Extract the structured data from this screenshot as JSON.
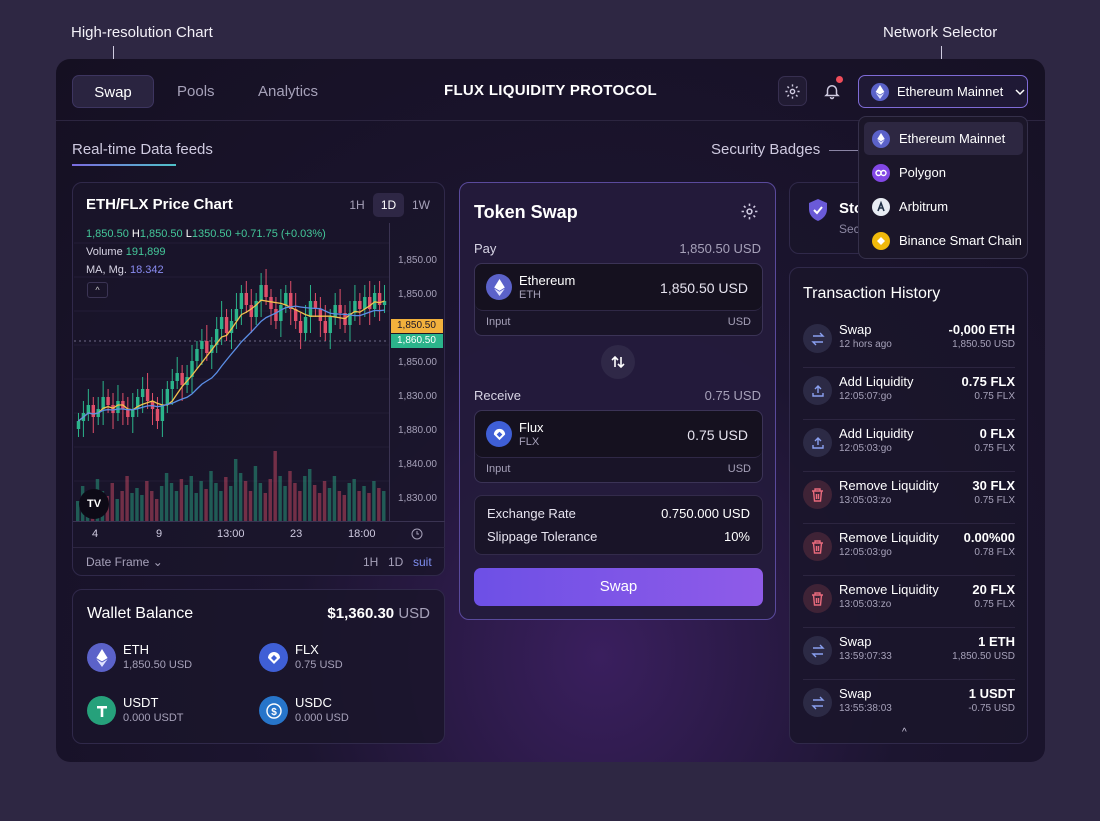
{
  "callouts": {
    "chart": "High-resolution Chart",
    "network": "Network Selector",
    "security": "Security Badges"
  },
  "header": {
    "tabs": [
      {
        "label": "Swap",
        "active": true
      },
      {
        "label": "Pools",
        "active": false
      },
      {
        "label": "Analytics",
        "active": false
      }
    ],
    "brand": "FLUX LIQUIDITY PROTOCOL",
    "network_selected": "Ethereum Mainnet"
  },
  "network_options": [
    {
      "label": "Ethereum Mainnet",
      "icon": "ethereum-icon",
      "color": "#5b62c9"
    },
    {
      "label": "Polygon",
      "icon": "polygon-icon",
      "color": "#8247e5"
    },
    {
      "label": "Arbitrum",
      "icon": "arbitrum-icon",
      "color": "#e8ecf3"
    },
    {
      "label": "Binance Smart Chain",
      "icon": "bnb-icon",
      "color": "#f0b90b"
    }
  ],
  "subhead": "Real-time Data feeds",
  "chart_panel": {
    "title": "ETH/FLX Price Chart",
    "timeframes": [
      "1H",
      "1D",
      "1W"
    ],
    "active_timeframe": "1D",
    "ohlc": {
      "open": "1,850.50",
      "h_label": "H",
      "high": "1,850.50",
      "l_label": "L",
      "low": "1350.50",
      "change": "+0.71.75 (+0.03%)"
    },
    "volume_label": "Volume",
    "volume_value": "191,899",
    "ma_label": "MA, Mg.",
    "ma_value": "18.342",
    "collapse_glyph": "^",
    "logo_text": "TV",
    "price_ticks": [
      "1,850.00",
      "1,850.00",
      "1,850.50",
      "1,860.50",
      "1,850.00",
      "1,830.00",
      "1,880.00",
      "1,840.00",
      "1,830.00"
    ],
    "time_ticks": [
      "4",
      "9",
      "13:00",
      "23",
      "18:00"
    ],
    "date_frame_label": "Date Frame",
    "footer_tfs": [
      "1H",
      "1D"
    ],
    "footer_link": "suit",
    "colors": {
      "up": "#2bb48b",
      "down": "#e04f6a",
      "ma_fast": "#f2c14e",
      "ma_slow": "#5b8ee6"
    }
  },
  "chart_data": {
    "type": "candlestick",
    "price_axis_ticks": [
      "1,850.00",
      "1,850.00",
      "1,850.00",
      "1,830.00",
      "1,880.00",
      "1,840.00",
      "1,830.00"
    ],
    "price_tags": [
      {
        "label": "1,850.50",
        "color": "#f2b13c"
      },
      {
        "label": "1,860.50",
        "color": "#2bb48b"
      }
    ],
    "x_ticks": [
      "4",
      "9",
      "13:00",
      "23",
      "18:00"
    ],
    "series": [
      {
        "kind": "candles",
        "close": [
          1830,
          1832,
          1834,
          1831,
          1833,
          1836,
          1834,
          1832,
          1835,
          1833,
          1831,
          1833,
          1836,
          1838,
          1835,
          1833,
          1830,
          1834,
          1838,
          1840,
          1842,
          1839,
          1841,
          1845,
          1848,
          1850,
          1847,
          1849,
          1853,
          1856,
          1852,
          1855,
          1858,
          1862,
          1859,
          1856,
          1860,
          1864,
          1861,
          1858,
          1855,
          1859,
          1862,
          1858,
          1855,
          1852,
          1856,
          1860,
          1858,
          1855,
          1852,
          1856,
          1859,
          1857,
          1854,
          1857,
          1860,
          1858,
          1861,
          1858,
          1862,
          1859,
          1860
        ]
      },
      {
        "kind": "volume",
        "values": [
          20,
          35,
          18,
          28,
          42,
          30,
          25,
          38,
          22,
          30,
          45,
          28,
          33,
          26,
          40,
          30,
          22,
          35,
          48,
          38,
          30,
          42,
          36,
          45,
          28,
          40,
          32,
          50,
          38,
          30,
          44,
          35,
          62,
          48,
          40,
          30,
          55,
          38,
          28,
          42,
          70,
          45,
          35,
          50,
          38,
          30,
          45,
          52,
          36,
          28,
          40,
          33,
          45,
          30,
          26,
          38,
          42,
          30,
          35,
          28,
          40,
          33,
          30
        ]
      },
      {
        "kind": "ma_fast"
      },
      {
        "kind": "ma_slow"
      }
    ]
  },
  "wallet": {
    "title": "Wallet Balance",
    "total": "$1,360.30",
    "unit": "USD",
    "assets": [
      {
        "symbol": "ETH",
        "amount": "1,850.50 USD",
        "color": "#5b62c9",
        "icon": "ethereum-icon"
      },
      {
        "symbol": "FLX",
        "amount": "0.75 USD",
        "color": "#3f5fd6",
        "icon": "flux-icon"
      },
      {
        "symbol": "USDT",
        "amount": "0.000 USDT",
        "color": "#26a17b",
        "icon": "tether-icon"
      },
      {
        "symbol": "USDC",
        "amount": "0.000 USD",
        "color": "#2775ca",
        "icon": "usdc-icon"
      }
    ]
  },
  "swap": {
    "title": "Token Swap",
    "pay_label": "Pay",
    "pay_value": "1,850.50 USD",
    "pay_token": {
      "name": "Ethereum",
      "symbol": "ETH",
      "amount": "1,850.50 USD",
      "input_label": "Input",
      "unit": "USD"
    },
    "receive_label": "Receive",
    "receive_value": "0.75 USD",
    "receive_token": {
      "name": "Flux",
      "symbol": "FLX",
      "amount": "0.75 USD",
      "input_label": "Input",
      "unit": "USD"
    },
    "rate_label": "Exchange Rate",
    "rate_value": "0.750.000 USD",
    "slippage_label": "Slippage Tolerance",
    "slippage_value": "10%",
    "button": "Swap"
  },
  "security": {
    "title": "Sto",
    "subtitle": "Sec"
  },
  "tx_history": {
    "title": "Transaction History",
    "rows": [
      {
        "type": "Swap",
        "time": "12 hors ago",
        "amount": "-0,000 ETH",
        "sub": "1,850.50 USD",
        "icon": "swap-icon"
      },
      {
        "type": "Add Liquidity",
        "time": "12:05:07:go",
        "amount": "0.75 FLX",
        "sub": "0.75 FLX",
        "icon": "add-liquidity-icon"
      },
      {
        "type": "Add Liquidity",
        "time": "12:05:03:go",
        "amount": "0 FLX",
        "sub": "0.75 FLX",
        "icon": "add-liquidity-icon"
      },
      {
        "type": "Remove Liquidity",
        "time": "13:05:03:zo",
        "amount": "30 FLX",
        "sub": "0.75 FLX",
        "icon": "trash-icon"
      },
      {
        "type": "Remove Liquidity",
        "time": "12:05:03:go",
        "amount": "0.00%00",
        "sub": "0.78 FLX",
        "icon": "trash-icon"
      },
      {
        "type": "Remove Liquidity",
        "time": "13:05:03:zo",
        "amount": "20 FLX",
        "sub": "0.75 FLX",
        "icon": "trash-icon"
      },
      {
        "type": "Swap",
        "time": "13:59:07:33",
        "amount": "1 ETH",
        "sub": "1,850.50 USD",
        "icon": "swap-icon"
      },
      {
        "type": "Swap",
        "time": "13:55:38:03",
        "amount": "1 USDT",
        "sub": "-0.75 USD",
        "icon": "swap-icon"
      }
    ],
    "scroll_glyph": "^"
  }
}
